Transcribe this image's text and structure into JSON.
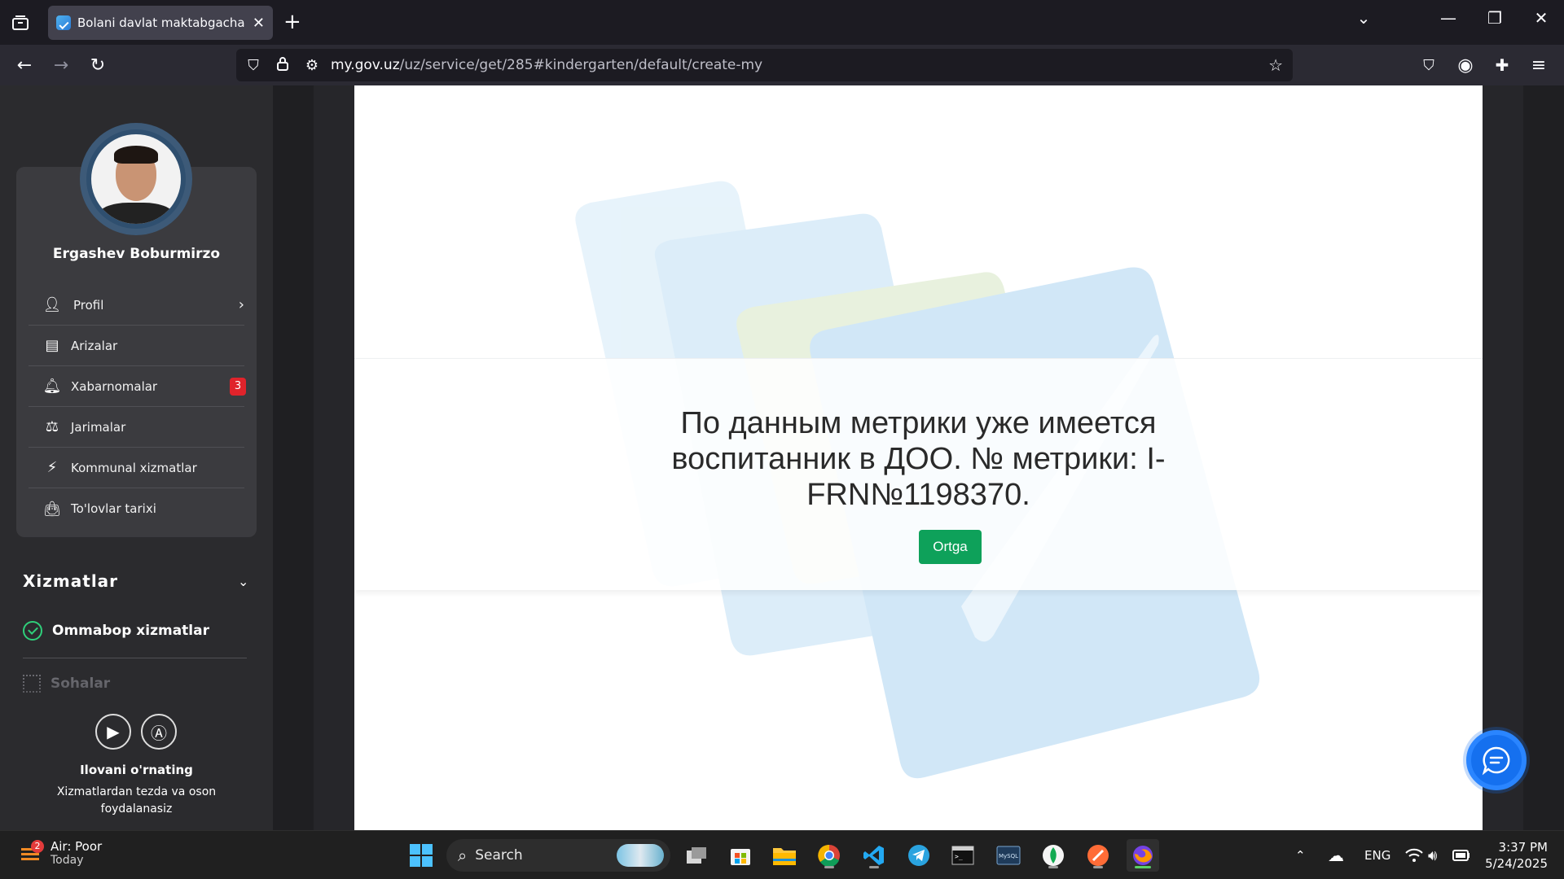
{
  "browser": {
    "tab_title": "Bolani davlat maktabgacha ta'lim",
    "url_domain": "my.gov.uz",
    "url_path": "/uz/service/get/285#kindergarten/default/create-my"
  },
  "sidebar": {
    "user_name": "Ergashev Boburmirzo",
    "menu": [
      {
        "label": "Profil"
      },
      {
        "label": "Arizalar"
      },
      {
        "label": "Xabarnomalar",
        "badge": "3"
      },
      {
        "label": "Jarimalar"
      },
      {
        "label": "Kommunal xizmatlar"
      },
      {
        "label": "To'lovlar tarixi"
      }
    ],
    "section_title": "Xizmatlar",
    "popular_label": "Ommabop xizmatlar",
    "sohalar_label": "Sohalar",
    "app_title": "Ilovani o'rnating",
    "app_subtitle": "Xizmatlardan tezda va oson foydalanasiz"
  },
  "main": {
    "message": "По данным метрики уже имеется воспитанник в ДОО. № метрики: I-FRN№1198370.",
    "back_button": "Ortga"
  },
  "taskbar": {
    "weather_badge": "2",
    "weather_line1": "Air: Poor",
    "weather_line2": "Today",
    "search_label": "Search",
    "lang": "ENG",
    "time": "3:37 PM",
    "date": "5/24/2025"
  },
  "colors": {
    "accent_green": "#0ea15a",
    "badge_red": "#e0232b",
    "chat_blue": "#1570ef"
  }
}
